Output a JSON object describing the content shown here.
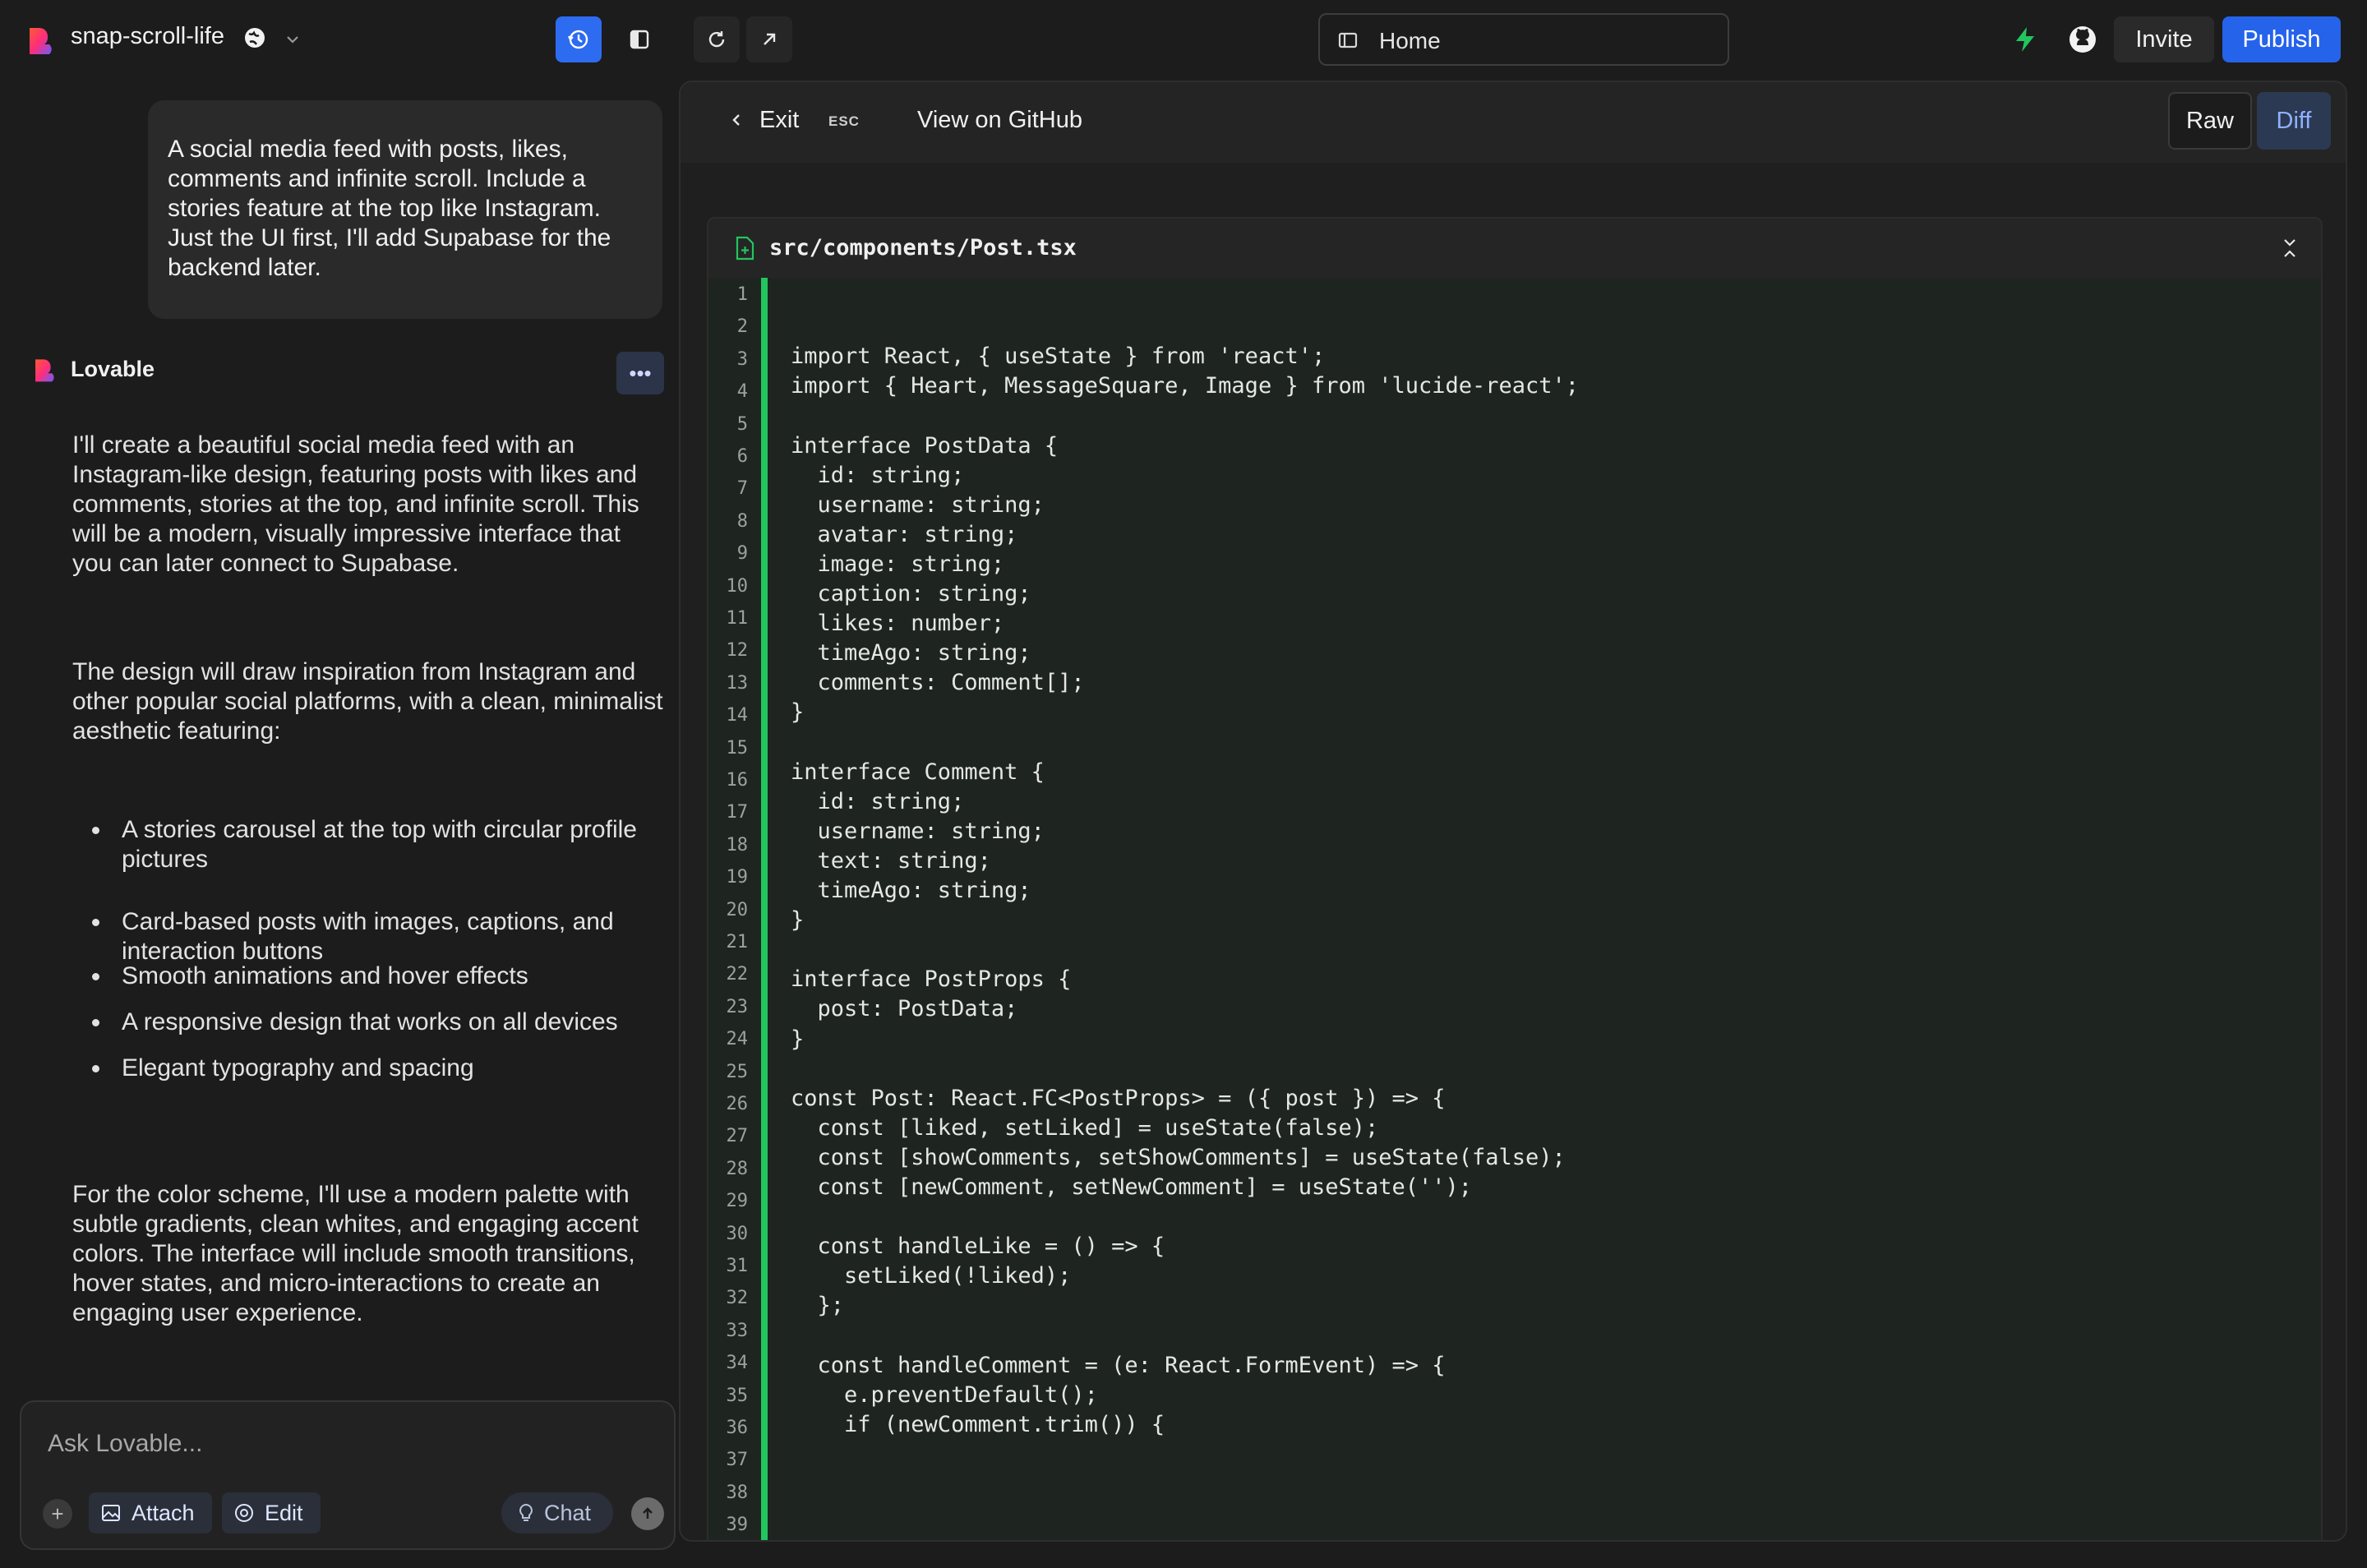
{
  "topbar": {
    "project_name": "snap-scroll-life",
    "url": "Home",
    "invite_label": "Invite",
    "publish_label": "Publish"
  },
  "chat": {
    "user_message": "A social media feed with posts, likes, comments and infinite scroll. Include a stories feature at the top like Instagram. Just the UI first, I'll add Supabase for the backend later.",
    "assistant_name": "Lovable",
    "assistant_paragraphs": [
      "I'll create a beautiful social media feed with an Instagram-like design, featuring posts with likes and comments, stories at the top, and infinite scroll. This will be a modern, visually impressive interface that you can later connect to Supabase.",
      "The design will draw inspiration from Instagram and other popular social platforms, with a clean, minimalist aesthetic featuring:",
      "For the color scheme, I'll use a modern palette with subtle gradients, clean whites, and engaging accent colors. The interface will include smooth transitions, hover states, and micro-interactions to create an engaging user experience."
    ],
    "bullets": [
      "A stories carousel at the top with circular profile pictures",
      "Card-based posts with images, captions, and interaction buttons",
      "Smooth animations and hover effects",
      "A responsive design that works on all devices",
      "Elegant typography and spacing"
    ]
  },
  "composer": {
    "placeholder": "Ask Lovable...",
    "attach_label": "Attach",
    "edit_label": "Edit",
    "chat_label": "Chat"
  },
  "code_panel": {
    "exit_label": "Exit",
    "esc_label": "ESC",
    "github_label": "View on GitHub",
    "raw_label": "Raw",
    "diff_label": "Diff",
    "file_path": "src/components/Post.tsx",
    "lines": [
      "",
      "",
      "import React, { useState } from 'react';",
      "import { Heart, MessageSquare, Image } from 'lucide-react';",
      "",
      "interface PostData {",
      "  id: string;",
      "  username: string;",
      "  avatar: string;",
      "  image: string;",
      "  caption: string;",
      "  likes: number;",
      "  timeAgo: string;",
      "  comments: Comment[];",
      "}",
      "",
      "interface Comment {",
      "  id: string;",
      "  username: string;",
      "  text: string;",
      "  timeAgo: string;",
      "}",
      "",
      "interface PostProps {",
      "  post: PostData;",
      "}",
      "",
      "const Post: React.FC<PostProps> = ({ post }) => {",
      "  const [liked, setLiked] = useState(false);",
      "  const [showComments, setShowComments] = useState(false);",
      "  const [newComment, setNewComment] = useState('');",
      "",
      "  const handleLike = () => {",
      "    setLiked(!liked);",
      "  };",
      "",
      "  const handleComment = (e: React.FormEvent) => {",
      "    e.preventDefault();",
      "    if (newComment.trim()) {",
      "    };",
      "  };"
    ],
    "line_numbers": [
      "1",
      "2",
      "3",
      "4",
      "5",
      "6",
      "7",
      "8",
      "9",
      "10",
      "11",
      "12",
      "13",
      "14",
      "15",
      "16",
      "17",
      "18",
      "19",
      "20",
      "21",
      "22",
      "23",
      "24",
      "25",
      "26",
      "27",
      "28",
      "29",
      "30",
      "31",
      "32",
      "33",
      "34",
      "35",
      "36",
      "37",
      "38",
      "39"
    ]
  },
  "colors": {
    "accent": "#2563eb",
    "diff_added": "#22c55e"
  }
}
